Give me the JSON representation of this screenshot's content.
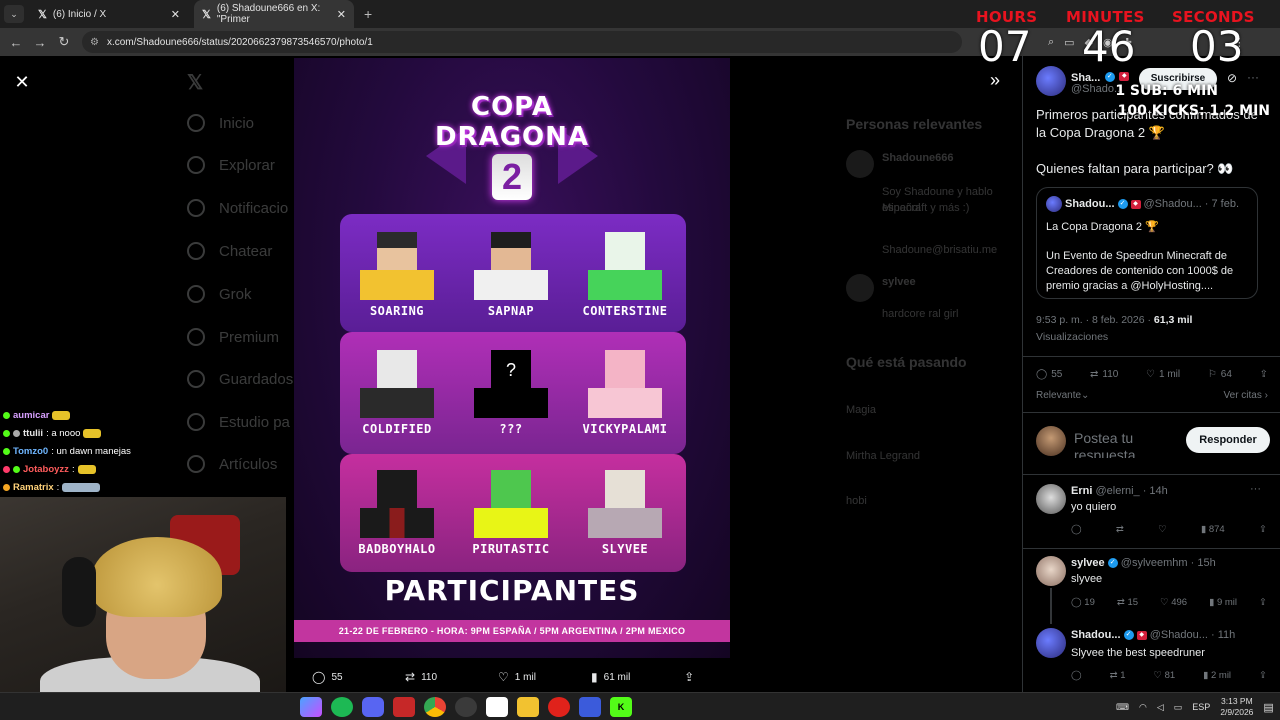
{
  "browser": {
    "tabs": [
      {
        "title": "(6) Inicio / X"
      },
      {
        "title": "(6) Shadoune666 en X: \"Primer"
      }
    ],
    "url": "x.com/Shadoune666/status/2020662379873546570/photo/1"
  },
  "background": {
    "nav": [
      "Inicio",
      "Explorar",
      "Notificacio",
      "Chatear",
      "Grok",
      "Premium",
      "Guardados",
      "Estudio pa",
      "Artículos"
    ],
    "right": {
      "relevant_heading": "Personas relevantes",
      "bio_name": "Shadoune666",
      "bio_lines": [
        "Soy Shadoune y hablo español",
        "Minecraft y más :)",
        "Shadoune@brisatiu.me"
      ],
      "second_name": "sylvee",
      "second_line": "hardcore ral girl",
      "trending_heading": "Qué está pasando",
      "trend_items": [
        "Magia",
        "Mirtha Legrand",
        "hobi"
      ]
    }
  },
  "poster": {
    "title_line1": "COPA",
    "title_line2": "DRAGONA",
    "number": "2",
    "players": [
      "SOARING",
      "SAPNAP",
      "CONTERSTINE",
      "COLDIFIED",
      "???",
      "VICKYPALAMI",
      "BADBOYHALO",
      "PIRUTASTIC",
      "SLYVEE"
    ],
    "participants_title": "PARTICIPANTES",
    "date_line": "21-22 DE FEBRERO - HORA: 9PM ESPAÑA / 5PM ARGENTINA / 2PM MEXICO"
  },
  "photo_actions": {
    "replies": "55",
    "reposts": "110",
    "likes": "1 mil",
    "views": "61 mil"
  },
  "tweet": {
    "name": "Sha...",
    "handle": "@Shado...",
    "subscribe_label": "Suscribirse",
    "text_line1": "Primeros participantes confirmados de",
    "text_line2": "la Copa Dragona 2 🏆",
    "text_line3": "Quienes faltan para participar? 👀",
    "quote": {
      "name": "Shadou...",
      "handle": "@Shadou...",
      "date": "· 7 feb.",
      "line1": "La Copa Dragona 2 🏆",
      "line2": "Un Evento de Speedrun Minecraft de",
      "line3": "Creadores de contenido con 1000$ de",
      "line4": "premio gracias a @HolyHosting...."
    },
    "time": "9:53 p. m. · 8 feb. 2026 ·",
    "views_count": "61,3 mil",
    "views_label": "Visualizaciones",
    "replies": "55",
    "reposts": "110",
    "likes": "1 mil",
    "bookmarks": "64",
    "sort_label": "Relevante",
    "quotes_label": "Ver citas"
  },
  "reply_composer": {
    "placeholder_line1": "Postea tu",
    "placeholder_line2": "respuesta",
    "button": "Responder"
  },
  "replies": [
    {
      "name": "Erni",
      "handle": "@elerni_ · 14h",
      "text": "yo quiero",
      "replies": "",
      "reposts": "",
      "likes": "",
      "views": "874"
    },
    {
      "name": "sylvee",
      "handle": "@sylveemhm · 15h",
      "text": "slyvee",
      "replies": "19",
      "reposts": "15",
      "likes": "496",
      "views": "9 mil"
    },
    {
      "name": "Shadou...",
      "handle": "@Shadou... · 11h",
      "text": "Slyvee the best speedruner",
      "replies": "",
      "reposts": "1",
      "likes": "81",
      "views": "2 mil"
    }
  ],
  "overlay": {
    "labels": [
      "HOURS",
      "MINUTES",
      "SECONDS"
    ],
    "hours": "07",
    "minutes": "46",
    "seconds": "03",
    "sub_line": "1 SUB: 6 MIN",
    "kicks_line": "100 KICKS: 1.2 MIN"
  },
  "chat": [
    {
      "user": "aumicar",
      "msg": ""
    },
    {
      "user": "ttulii",
      "msg": ": a nooo"
    },
    {
      "user": "Tomzo0",
      "msg": ": un dawn manejas"
    },
    {
      "user": "Jotaboyzz",
      "msg": ":"
    },
    {
      "user": "Ramatrix",
      "msg": ":"
    }
  ],
  "taskbar": {
    "lang": "ESP",
    "time": "3:13 PM",
    "date": "2/9/2026"
  }
}
